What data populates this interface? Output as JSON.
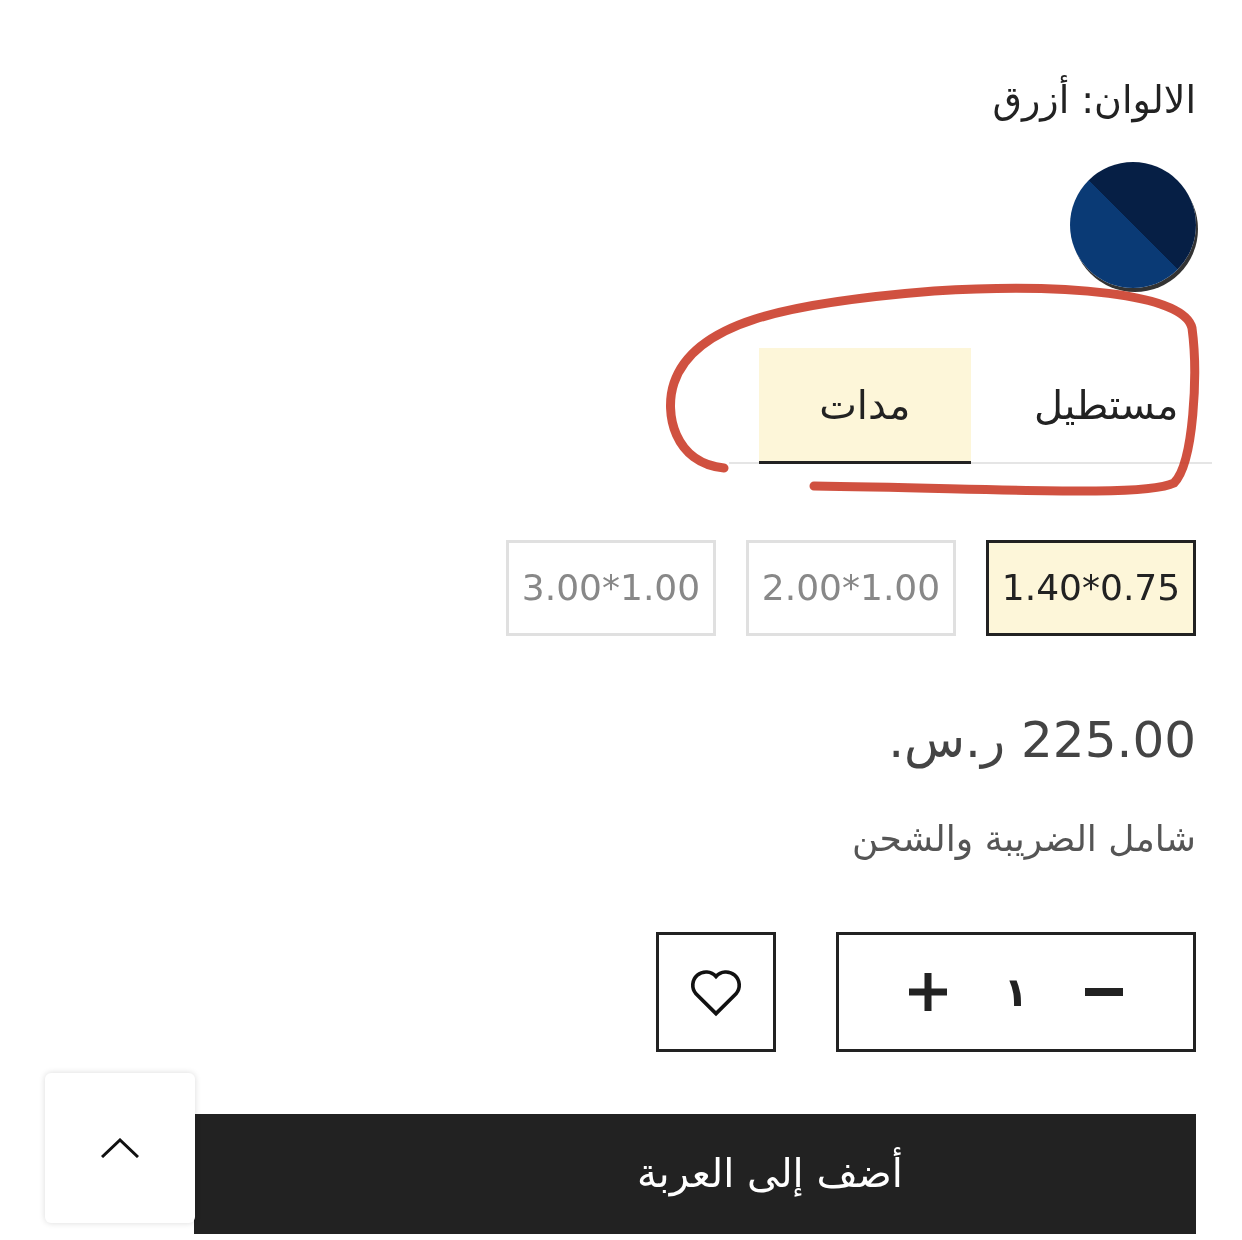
{
  "color_label": "الالوان: أزرق",
  "swatches": [
    {
      "color": "#0a3a75",
      "selected": true
    }
  ],
  "tabs": [
    {
      "label": "مستطيل",
      "selected": false
    },
    {
      "label": "مدات",
      "selected": true
    }
  ],
  "sizes": [
    {
      "label": "1.40*0.75",
      "selected": true
    },
    {
      "label": "2.00*1.00",
      "selected": false
    },
    {
      "label": "3.00*1.00",
      "selected": false
    }
  ],
  "price": "225.00 ر.س.",
  "tax_note": "شامل الضريبة والشحن",
  "quantity": "١",
  "add_to_cart": "أضف إلى العربة"
}
